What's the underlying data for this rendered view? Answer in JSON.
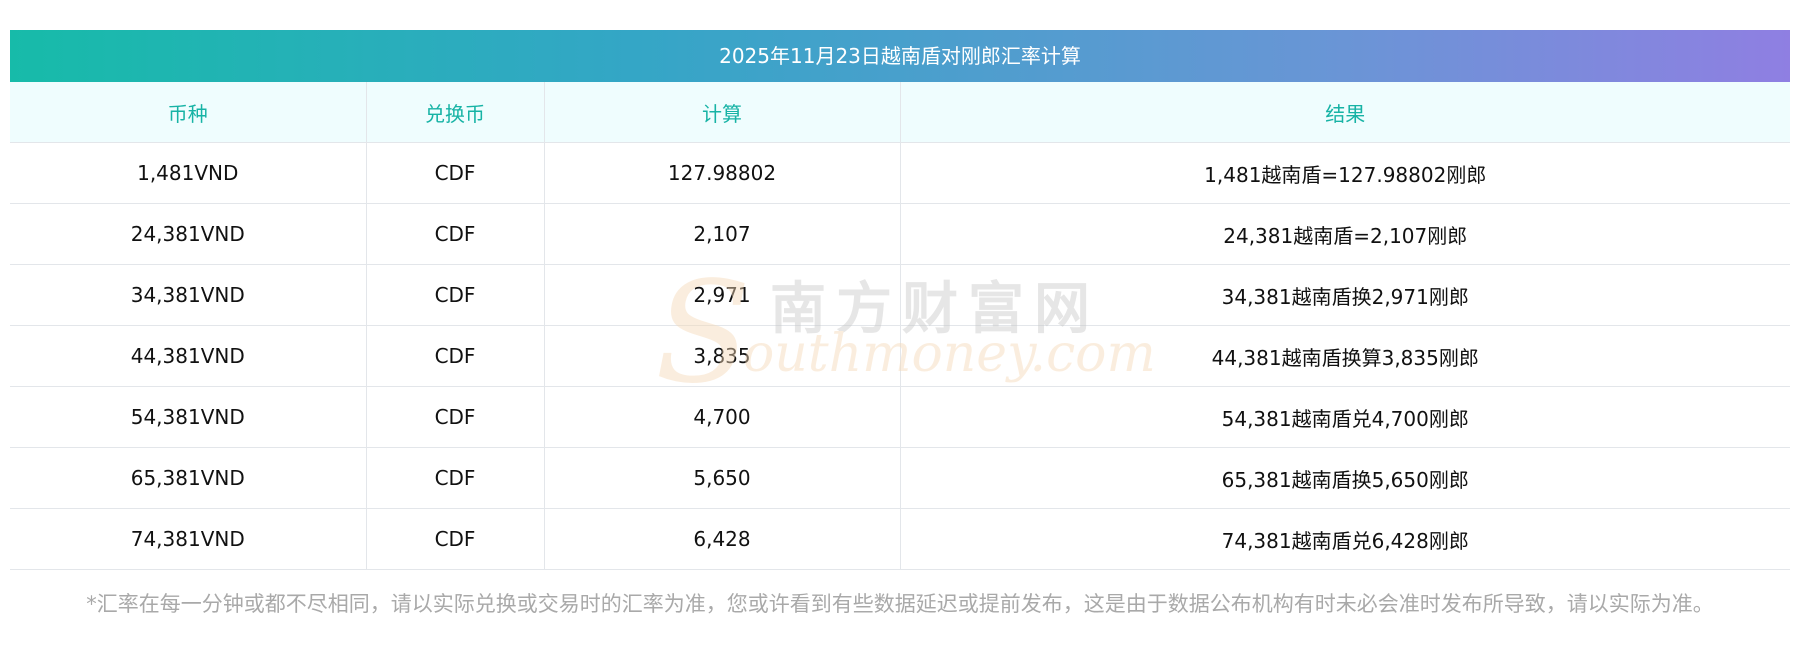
{
  "title": "2025年11月23日越南盾对刚郎汇率计算",
  "columns": [
    "币种",
    "兑换币",
    "计算",
    "结果"
  ],
  "rows": [
    [
      "1,481VND",
      "CDF",
      "127.98802",
      "1,481越南盾=127.98802刚郎"
    ],
    [
      "24,381VND",
      "CDF",
      "2,107",
      "24,381越南盾=2,107刚郎"
    ],
    [
      "34,381VND",
      "CDF",
      "2,971",
      "34,381越南盾换2,971刚郎"
    ],
    [
      "44,381VND",
      "CDF",
      "3,835",
      "44,381越南盾换算3,835刚郎"
    ],
    [
      "54,381VND",
      "CDF",
      "4,700",
      "54,381越南盾兑4,700刚郎"
    ],
    [
      "65,381VND",
      "CDF",
      "5,650",
      "65,381越南盾换5,650刚郎"
    ],
    [
      "74,381VND",
      "CDF",
      "6,428",
      "74,381越南盾兑6,428刚郎"
    ]
  ],
  "note": "*汇率在每一分钟或都不尽相同，请以实际兑换或交易时的汇率为准，您或许看到有些数据延迟或提前发布，这是由于数据公布机构有时未必会准时发布所导致，请以实际为准。",
  "watermark": {
    "initial": "S",
    "cn": "南方财富网",
    "en": "outhmoney.com"
  },
  "colors": {
    "title_gradient_start": "#17bba9",
    "title_gradient_end": "#8f7fe2",
    "header_text": "#17b3a5",
    "header_bg": "#effdfe",
    "note_text": "#a9a9a9"
  }
}
